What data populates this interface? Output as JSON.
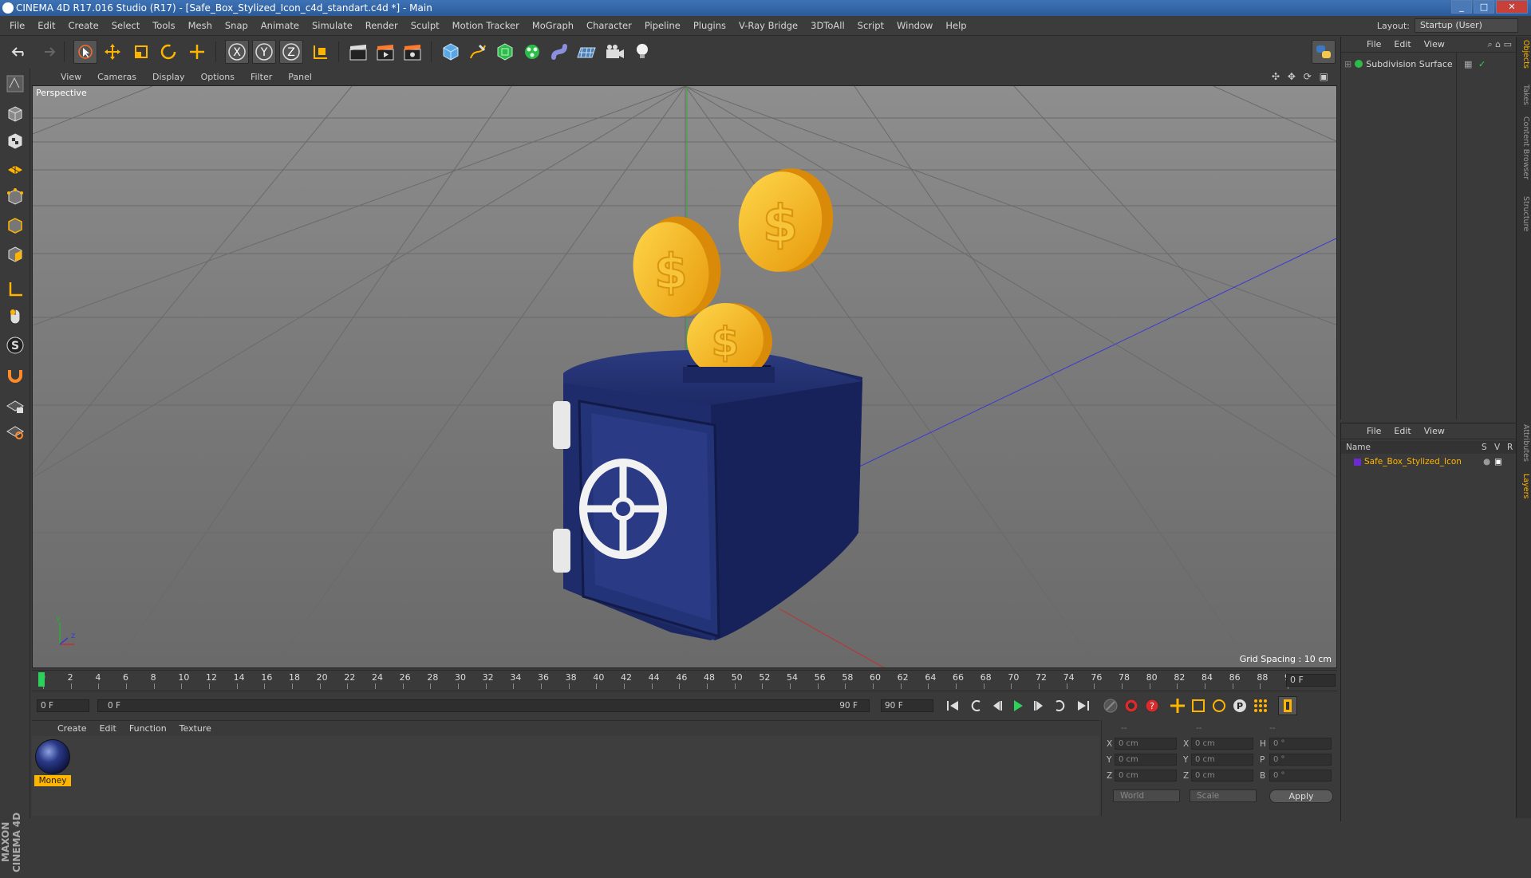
{
  "window": {
    "title": "CINEMA 4D R17.016 Studio (R17) - [Safe_Box_Stylized_Icon_c4d_standart.c4d *] - Main",
    "buttons": [
      "_",
      "□",
      "✕"
    ]
  },
  "menubar": {
    "items": [
      "File",
      "Edit",
      "Create",
      "Select",
      "Tools",
      "Mesh",
      "Snap",
      "Animate",
      "Simulate",
      "Render",
      "Sculpt",
      "Motion Tracker",
      "MoGraph",
      "Character",
      "Pipeline",
      "Plugins",
      "V-Ray Bridge",
      "3DToAll",
      "Script",
      "Window",
      "Help"
    ],
    "layout_label": "Layout:",
    "layout_value": "Startup (User)"
  },
  "toolbar": {
    "axis_x": "X",
    "axis_y": "Y",
    "axis_z": "Z"
  },
  "viewport": {
    "menu": [
      "View",
      "Cameras",
      "Display",
      "Options",
      "Filter",
      "Panel"
    ],
    "label": "Perspective",
    "grid_spacing": "Grid Spacing : 10 cm",
    "nav_icons": "✣ ✥ ⟳ ▣",
    "axis_y": "y",
    "axis_z": "z"
  },
  "timeline": {
    "ticks": [
      "0",
      "2",
      "4",
      "6",
      "8",
      "10",
      "12",
      "14",
      "16",
      "18",
      "20",
      "22",
      "24",
      "26",
      "28",
      "30",
      "32",
      "34",
      "36",
      "38",
      "40",
      "42",
      "44",
      "46",
      "48",
      "50",
      "52",
      "54",
      "56",
      "58",
      "60",
      "62",
      "64",
      "66",
      "68",
      "70",
      "72",
      "74",
      "76",
      "78",
      "80",
      "82",
      "84",
      "86",
      "88",
      "90"
    ],
    "current_frame": "0 F"
  },
  "transport": {
    "start_frame": "0 F",
    "range_start": "0 F",
    "range_end": "90 F",
    "end_frame": "90 F"
  },
  "materials": {
    "menu": [
      "Create",
      "Edit",
      "Function",
      "Texture"
    ],
    "items": [
      {
        "name": "Money"
      }
    ]
  },
  "coordinates": {
    "header": [
      "--",
      "--",
      "--"
    ],
    "rows": [
      {
        "label": "X",
        "pos": "0 cm",
        "size_label": "X",
        "size": "0 cm",
        "rot_label": "H",
        "rot": "0 °"
      },
      {
        "label": "Y",
        "pos": "0 cm",
        "size_label": "Y",
        "size": "0 cm",
        "rot_label": "P",
        "rot": "0 °"
      },
      {
        "label": "Z",
        "pos": "0 cm",
        "size_label": "Z",
        "size": "0 cm",
        "rot_label": "B",
        "rot": "0 °"
      }
    ],
    "mode": "World",
    "scale": "Scale",
    "apply": "Apply"
  },
  "objects_panel": {
    "menu": [
      "File",
      "Edit",
      "View"
    ],
    "items": [
      {
        "name": "Subdivision Surface"
      }
    ]
  },
  "layers_panel": {
    "menu": [
      "File",
      "Edit",
      "View"
    ],
    "columns": {
      "name": "Name",
      "s": "S",
      "v": "V",
      "r": "R"
    },
    "items": [
      {
        "name": "Safe_Box_Stylized_Icon"
      }
    ]
  },
  "side_tabs": [
    "Objects",
    "Takes",
    "Content Browser",
    "Structure",
    "Attributes",
    "Layers"
  ],
  "brand": "MAXON CINEMA 4D",
  "colors": {
    "accent": "#ffb400",
    "safe_body": "#1c2a66",
    "coin": "#f4b21c"
  }
}
